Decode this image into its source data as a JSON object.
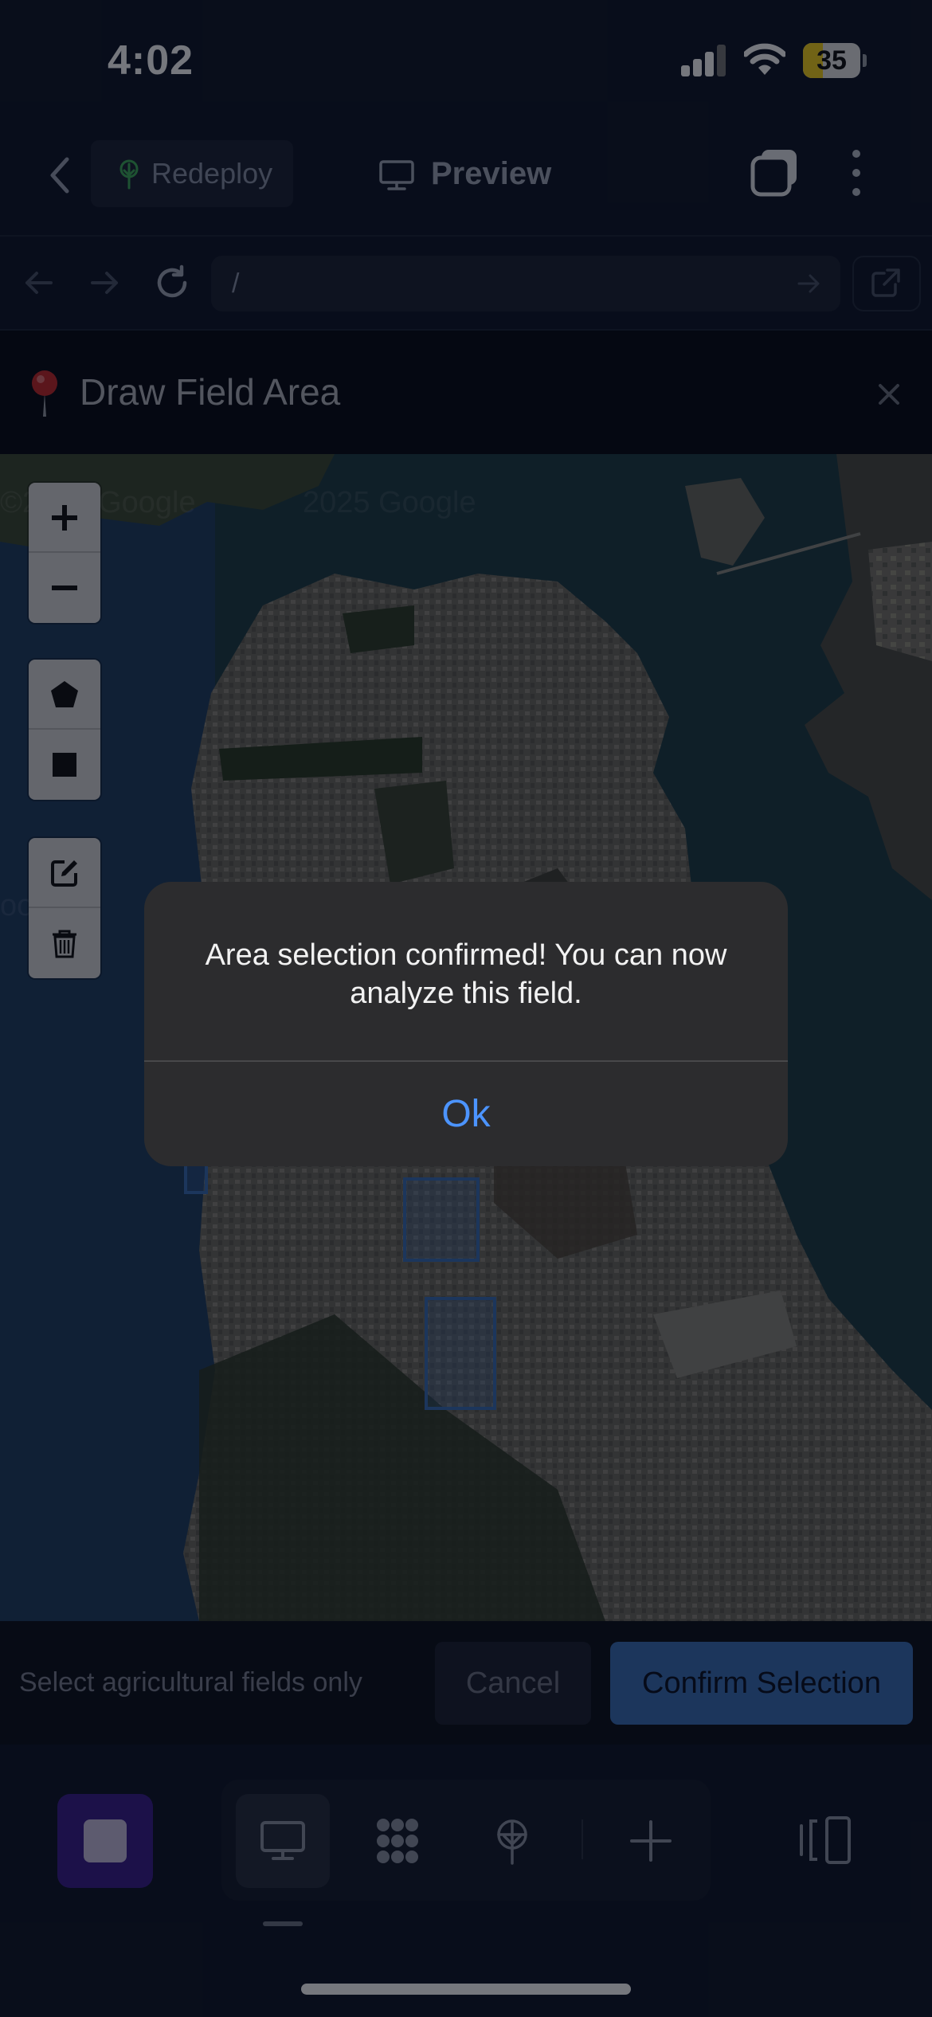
{
  "status_bar": {
    "time": "4:02",
    "battery": "35",
    "battery_fraction": 0.35
  },
  "header": {
    "redeploy_label": "Redeploy",
    "preview_label": "Preview"
  },
  "browser": {
    "url": "/"
  },
  "modal": {
    "title": "Draw Field Area",
    "footer_hint": "Select agricultural fields only",
    "cancel_label": "Cancel",
    "confirm_label": "Confirm Selection"
  },
  "map": {
    "watermarks": [
      "2025 Google",
      "©2025 Google",
      "oogle"
    ],
    "controls": [
      "zoom-in",
      "zoom-out",
      "draw-polygon",
      "draw-rectangle",
      "edit-layers",
      "delete-layers"
    ]
  },
  "alert": {
    "message": "Area selection confirmed! You can now analyze this field.",
    "ok_label": "Ok"
  },
  "icons": {
    "back": "chevron-left-icon",
    "redeploy": "tree-icon",
    "preview": "monitor-icon",
    "tabs": "tabs-icon",
    "more": "more-vertical-icon",
    "pin": "map-pin-icon"
  },
  "colors": {
    "accent": "#3a6fb6",
    "alert_button": "#4c94ff",
    "stop": "#3b1d8c"
  }
}
